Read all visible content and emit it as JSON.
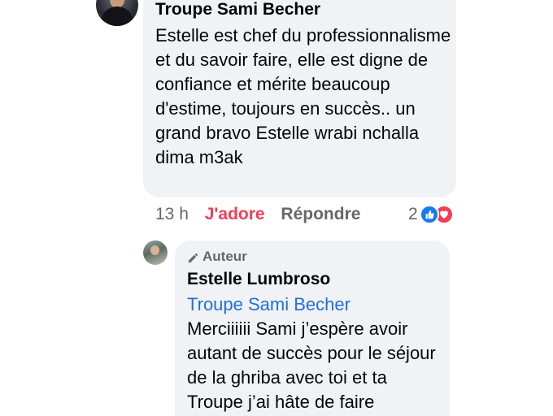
{
  "comment": {
    "author": "Troupe Sami Becher",
    "text": "Estelle est chef du professionnalisme et du savoir faire, elle est digne de confiance et mérite beaucoup d'estime, toujours en succès.. un grand bravo Estelle wrabi nchalla dima m3ak",
    "time": "13 h",
    "reaction_label": "J'adore",
    "reply_label": "Répondre",
    "reaction_count": "2",
    "reaction_icons": [
      "like-icon",
      "heart-icon"
    ]
  },
  "reply": {
    "badge": "Auteur",
    "badge_icon": "pencil-icon",
    "author": "Estelle Lumbroso",
    "mention": "Troupe Sami Becher",
    "text": "Merciiiiii Sami j’espère avoir autant de succès pour le séjour de la ghriba avec toi et ta Troupe j’ai hâte de faire"
  },
  "colors": {
    "bubble": "#f0f2f5",
    "love": "#f33e58",
    "like": "#1877f2",
    "mention": "#216fdb",
    "secondary_text": "#65676b"
  }
}
